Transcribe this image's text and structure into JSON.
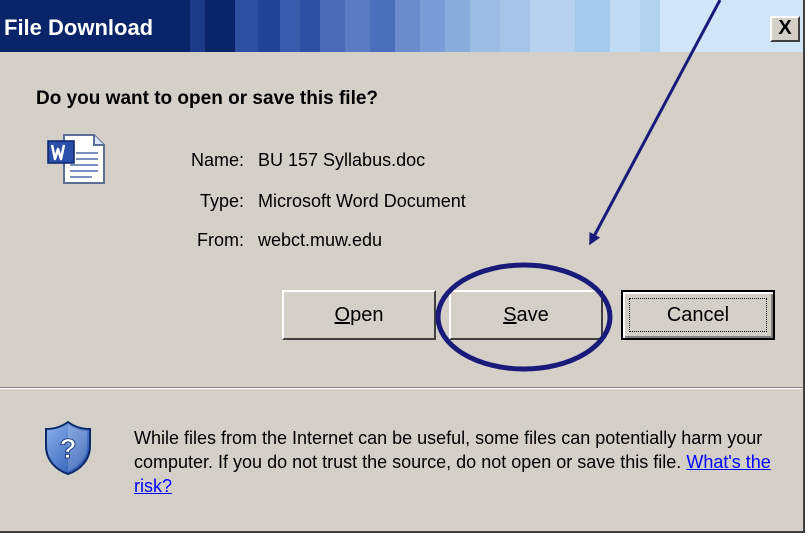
{
  "window": {
    "title": "File Download",
    "close_glyph": "X"
  },
  "dialog": {
    "question": "Do you want to open or save this file?",
    "file_icon": "word-document-icon",
    "info": {
      "name_label": "Name:",
      "name_value": "BU 157 Syllabus.doc",
      "type_label": "Type:",
      "type_value": "Microsoft Word Document",
      "from_label": "From:",
      "from_value": "webct.muw.edu"
    },
    "buttons": {
      "open_first": "O",
      "open_rest": "pen",
      "save_first": "S",
      "save_rest": "ave",
      "cancel": "Cancel"
    }
  },
  "security": {
    "icon": "shield-question-icon",
    "warning_text": "While files from the Internet can be useful, some files can potentially harm your computer. If you do not trust the source, do not open or save this file.",
    "risk_link": "What's the risk?"
  },
  "annotation": {
    "arrow": "pointer-arrow",
    "circle": "highlight-circle",
    "color": "#1a1a7a"
  },
  "colors": {
    "dialog_bg": "#d4d0c8",
    "title_dark": "#0a246a",
    "link": "#0000ff"
  }
}
